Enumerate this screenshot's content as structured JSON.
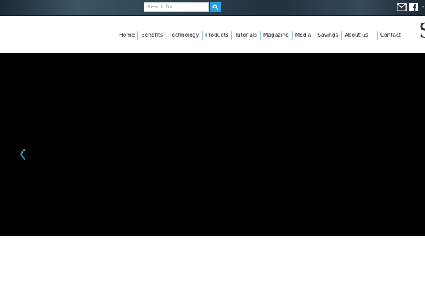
{
  "topbar": {
    "search": {
      "placeholder": "Search for..."
    },
    "search_icon": "search-icon",
    "mail_icon": "mail-icon",
    "social_icon": "facebook-icon",
    "trailing_mark": "-"
  },
  "nav": {
    "items": [
      {
        "label": "Home"
      },
      {
        "label": "Benefits"
      },
      {
        "label": "Technology"
      },
      {
        "label": "Products"
      },
      {
        "label": "Tutorials"
      },
      {
        "label": "Magazine"
      },
      {
        "label": "Media"
      },
      {
        "label": "Savings"
      },
      {
        "label": "About us"
      },
      {
        "label": "Contact"
      }
    ]
  },
  "logo": {
    "glyph": "S"
  },
  "slider": {
    "prev_icon": "chevron-left-icon"
  },
  "colors": {
    "accent": "#2b9fd6",
    "nav_divider": "#9ec9dc",
    "slider_bg": "#000000"
  }
}
